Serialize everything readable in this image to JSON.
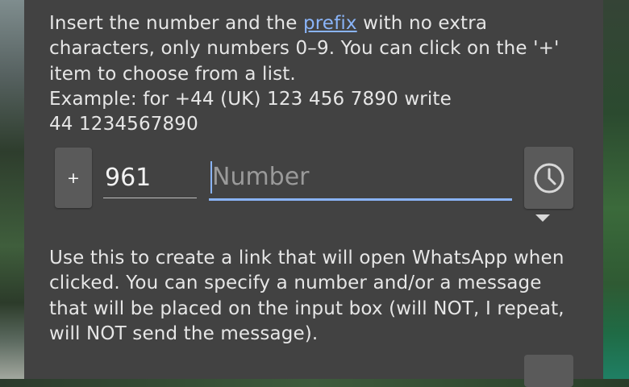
{
  "instructions": {
    "line1_pre": "Insert the number and the ",
    "line1_link": "prefix",
    "line1_post": " with no extra",
    "line2": "characters, only numbers 0–9. You can click on the '+'",
    "line3": "item to choose from a list.",
    "line4": "Example: for +44 (UK) 123 456 7890 write",
    "line5": "44 1234567890"
  },
  "phone": {
    "plus_label": "+",
    "prefix_value": "961",
    "number_placeholder": "Number",
    "history_icon": "clock-icon",
    "dropdown_icon": "caret-down-icon"
  },
  "description": {
    "line1": "Use this to create a link that will open WhatsApp when",
    "line2": "clicked. You can specify a number and/or a message",
    "line3": "that will be placed on the input box (will NOT, I repeat,",
    "line4": "will NOT send the message)."
  },
  "colors": {
    "dialog_bg": "#424242",
    "accent": "#8ab4f8",
    "button_bg": "#5a5a5a",
    "text": "#e6e6e6"
  }
}
